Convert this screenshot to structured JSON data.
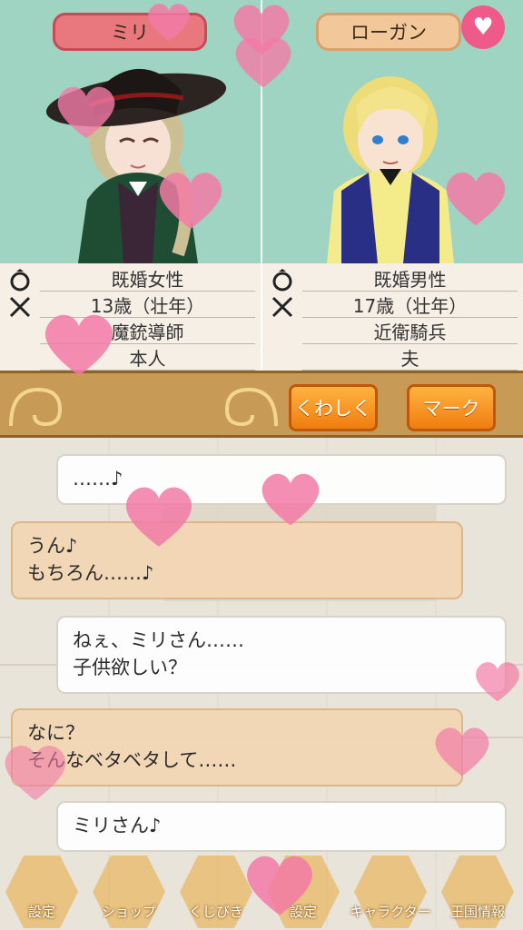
{
  "characters": {
    "left": {
      "name": "ミリ",
      "rows": [
        "既婚女性",
        "13歳（壮年）",
        "魔銃導師",
        "本人"
      ]
    },
    "right": {
      "name": "ローガン",
      "rows": [
        "既婚男性",
        "17歳（壮年）",
        "近衛騎兵",
        "夫"
      ]
    }
  },
  "actions": {
    "detail": "くわしく",
    "mark": "マーク"
  },
  "messages": [
    {
      "speaker": "right",
      "text": "……♪"
    },
    {
      "speaker": "left",
      "text": "うん♪\nもちろん……♪"
    },
    {
      "speaker": "right",
      "text": "ねぇ、ミリさん……\n子供欲しい？"
    },
    {
      "speaker": "left",
      "text": "なに？\nそんなベタベタして……"
    },
    {
      "speaker": "right",
      "text": "ミリさん♪"
    }
  ],
  "nav": [
    "設定",
    "ショップ",
    "くじびき",
    "設定",
    "キャラクター",
    "王国情報"
  ],
  "colors": {
    "panel_bg": "#9fd4c2",
    "heart": "#f27aa6",
    "button": "#ef7d0f"
  }
}
